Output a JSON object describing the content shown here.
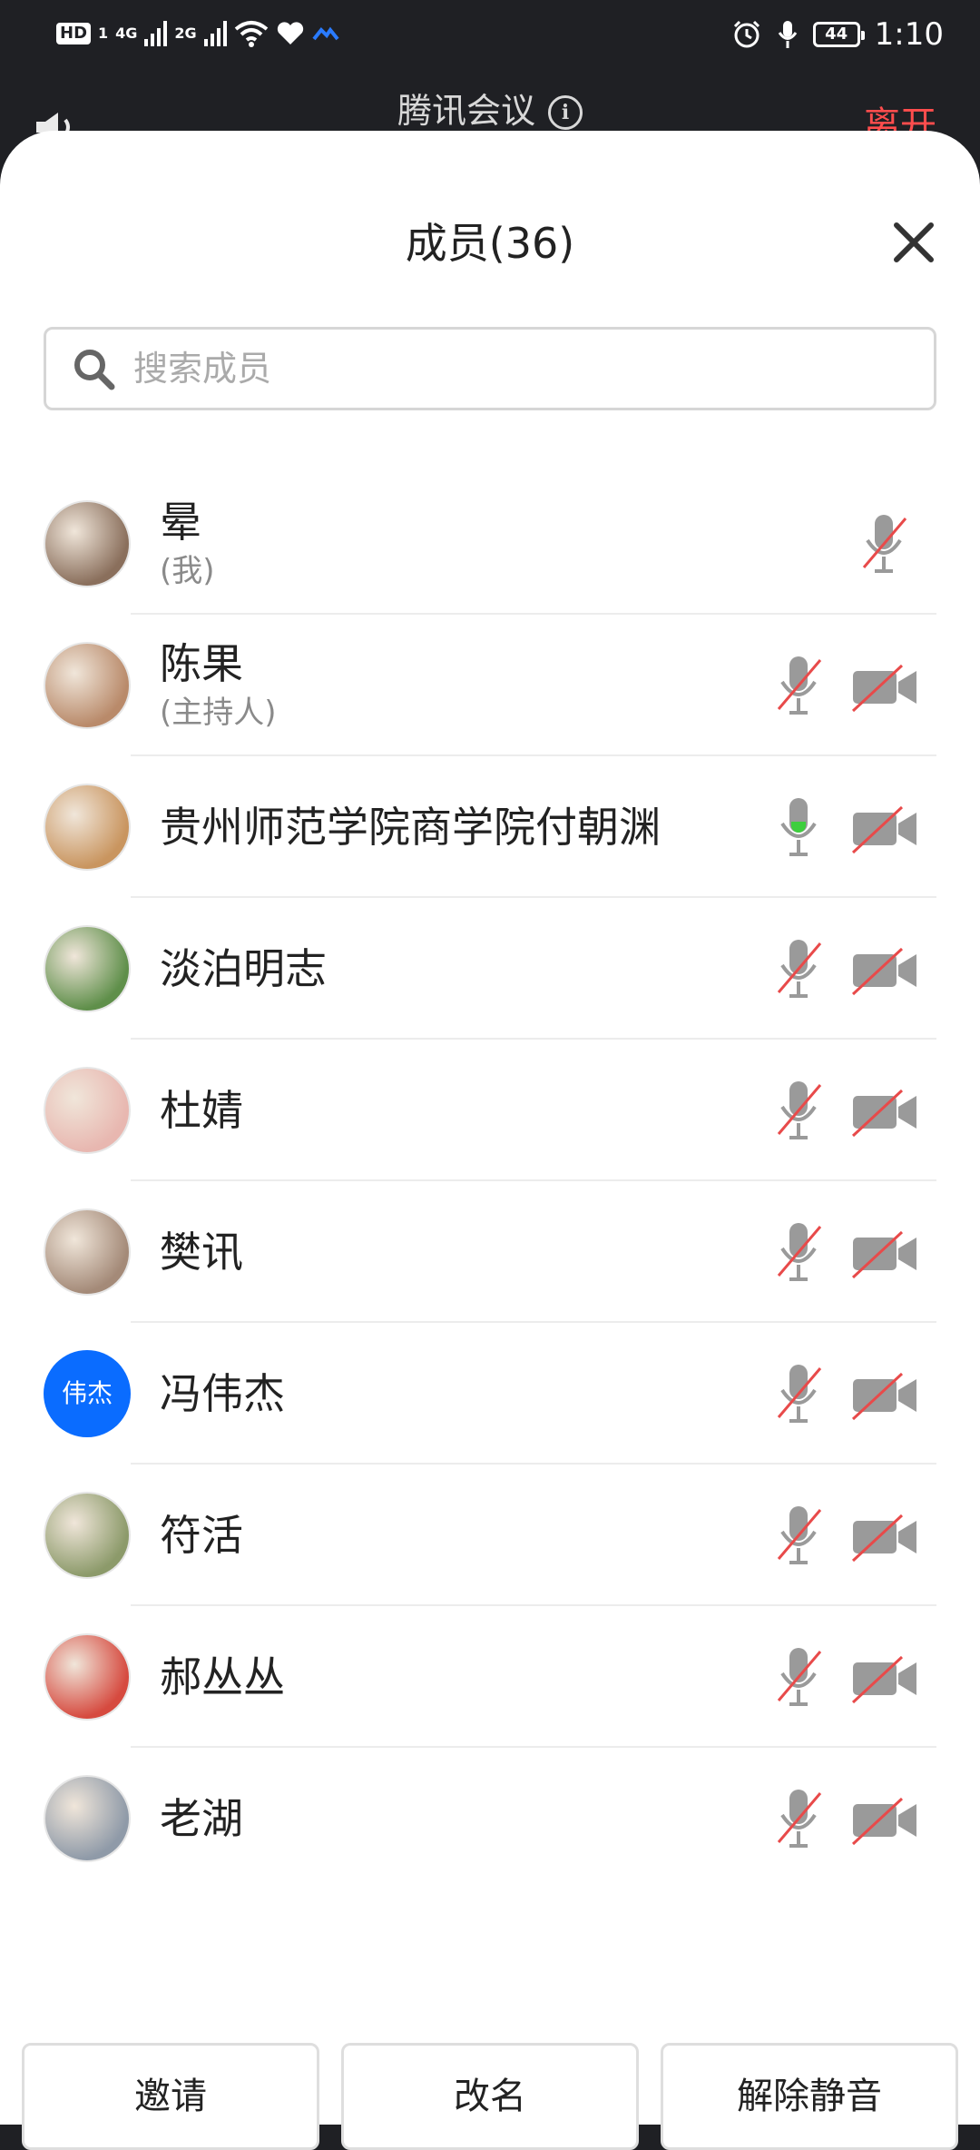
{
  "status_bar": {
    "hd": "HD",
    "sim": "1",
    "net1": "4G",
    "net2": "2G",
    "battery": "44",
    "time": "1:10"
  },
  "meeting": {
    "title": "腾讯会议",
    "leave_label": "离开"
  },
  "panel": {
    "title": "成员(36)",
    "search_placeholder": "搜索成员"
  },
  "members": [
    {
      "name": "晕",
      "role": "(我)",
      "mic_active": false,
      "has_camera_icon": false,
      "avatar_color": "#8a6f5c"
    },
    {
      "name": "陈果",
      "role": "(主持人)",
      "mic_active": false,
      "has_camera_icon": true,
      "avatar_color": "#b98a6a"
    },
    {
      "name": "贵州师范学院商学院付朝渊",
      "role": "",
      "mic_active": true,
      "has_camera_icon": true,
      "avatar_color": "#c9955f"
    },
    {
      "name": "淡泊明志",
      "role": "",
      "mic_active": false,
      "has_camera_icon": true,
      "avatar_color": "#5f8f4a"
    },
    {
      "name": "杜婧",
      "role": "",
      "mic_active": false,
      "has_camera_icon": true,
      "avatar_color": "#e8b7b0"
    },
    {
      "name": "樊讯",
      "role": "",
      "mic_active": false,
      "has_camera_icon": true,
      "avatar_color": "#a48a78"
    },
    {
      "name": "冯伟杰",
      "role": "",
      "mic_active": false,
      "has_camera_icon": true,
      "avatar_text": "伟杰",
      "avatar_color": "#0a6cff"
    },
    {
      "name": "符活",
      "role": "",
      "mic_active": false,
      "has_camera_icon": true,
      "avatar_color": "#8c9a6a"
    },
    {
      "name": "郝丛丛",
      "role": "",
      "mic_active": false,
      "has_camera_icon": true,
      "avatar_color": "#d64a3f"
    },
    {
      "name": "老湖",
      "role": "",
      "mic_active": false,
      "has_camera_icon": true,
      "avatar_color": "#8f9aa8"
    }
  ],
  "actions": {
    "invite": "邀请",
    "rename": "改名",
    "unmute_all": "解除静音"
  },
  "colors": {
    "mic_green": "#3ecf3e",
    "strike_red": "#e84a4a",
    "icon_gray": "#9a9a9a"
  }
}
